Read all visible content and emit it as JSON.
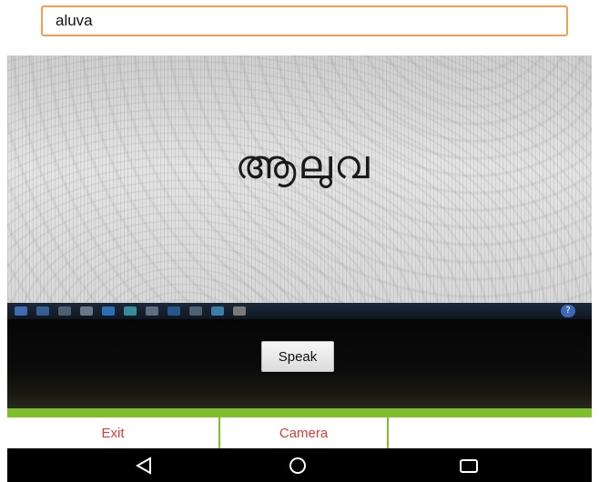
{
  "result_field": {
    "value": "aluva"
  },
  "camera_preview": {
    "captured_text": "ആലുവ"
  },
  "speak_button": {
    "label": "Speak"
  },
  "action_bar": {
    "exit_label": "Exit",
    "camera_label": "Camera"
  },
  "colors": {
    "accent_green": "#7fbf2a",
    "action_text_red": "#e53935",
    "field_border_orange": "#f0a050"
  },
  "nav_bar": {
    "back_icon": "triangle-back-icon",
    "home_icon": "circle-home-icon",
    "recents_icon": "square-recents-icon"
  }
}
